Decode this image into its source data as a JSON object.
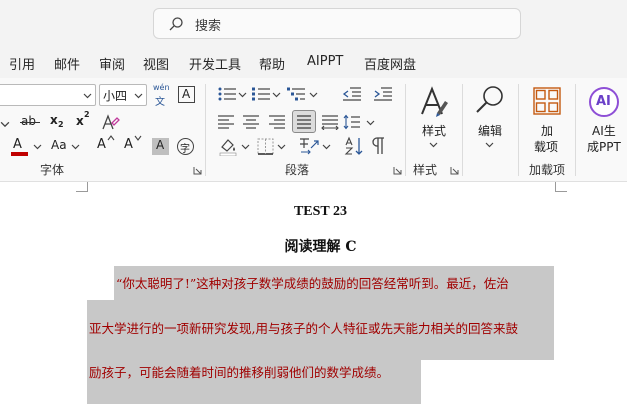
{
  "search": {
    "placeholder": "搜索"
  },
  "tabs": [
    "引用",
    "邮件",
    "审阅",
    "视图",
    "开发工具",
    "帮助",
    "AIPPT",
    "百度网盘"
  ],
  "ribbon": {
    "font": {
      "font_size_value": "小四",
      "phonetic_top": "wén",
      "phonetic_bottom": "文",
      "char_border": "A",
      "strike": "ab",
      "subscript": "x",
      "subscript_mark": "2",
      "superscript": "x",
      "superscript_mark": "2",
      "font_color_glyph": "A",
      "case_glyph": "Aa",
      "grow_glyph": "A",
      "shrink_glyph": "A",
      "shading_glyph": "A",
      "enclose_glyph": "字",
      "group_label": "字体"
    },
    "paragraph": {
      "group_label": "段落"
    },
    "styles": {
      "button_label": "样式",
      "group_label": "样式"
    },
    "editing": {
      "button_label": "编辑"
    },
    "addins": {
      "button_line1": "加",
      "button_line2": "载项",
      "group_label": "加载项"
    },
    "ai": {
      "badge": "AI",
      "button_line1": "AI生",
      "button_line2": "成PPT"
    }
  },
  "colors": {
    "font_color_bar": "#c00000",
    "doc_text": "#a00000",
    "highlight": "#c8c8c8"
  },
  "document": {
    "heading1": "TEST 23",
    "heading2": "阅读理解 C",
    "lines": [
      "“你太聪明了!”这种对孩子数学成绩的鼓励的回答经常听到。最近，佐治",
      "亚大学进行的一项新研究发现,用与孩子的个人特征或先天能力相关的回答来鼓",
      "励孩子，可能会随着时间的推移削弱他们的数学成绩。"
    ]
  }
}
